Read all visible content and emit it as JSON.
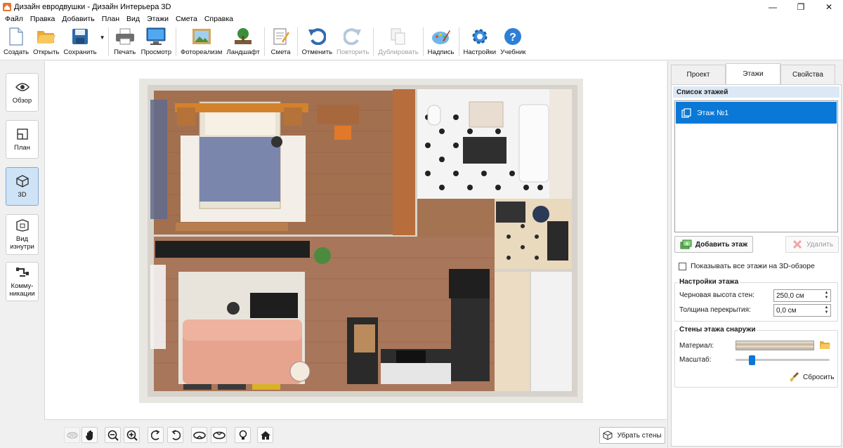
{
  "window": {
    "title": "Дизайн евродвушки - Дизайн Интерьера 3D",
    "minimize": "—",
    "maximize": "❐",
    "close": "✕"
  },
  "menu": [
    "Файл",
    "Правка",
    "Добавить",
    "План",
    "Вид",
    "Этажи",
    "Смета",
    "Справка"
  ],
  "toolbar": {
    "create": "Создать",
    "open": "Открыть",
    "save": "Сохранить",
    "print": "Печать",
    "preview": "Просмотр",
    "photorealism": "Фотореализм",
    "landscape": "Ландшафт",
    "estimate": "Смета",
    "undo": "Отменить",
    "redo": "Повторить",
    "duplicate": "Дублировать",
    "caption": "Надпись",
    "settings": "Настройки",
    "tutorial": "Учебник"
  },
  "sidebar": {
    "overview": "Обзор",
    "plan": "План",
    "view3d": "3D",
    "inside_view": "Вид изнутри",
    "communications": "Комму- никации"
  },
  "bottombar": {
    "remove_walls": "Убрать стены"
  },
  "rightpanel": {
    "tabs": [
      "Проект",
      "Этажи",
      "Свойства"
    ],
    "active_tab": "Этажи",
    "floor_list_title": "Список этажей",
    "floors": [
      "Этаж №1"
    ],
    "add_floor": "Добавить этаж",
    "delete": "Удалить",
    "show_all_floors": "Показывать все этажи на 3D-обзоре",
    "floor_settings_title": "Настройки этажа",
    "wall_height_label": "Черновая высота стен:",
    "wall_height_value": "250,0 см",
    "slab_thickness_label": "Толщина перекрытия:",
    "slab_thickness_value": "0,0 см",
    "outer_walls_title": "Стены этажа снаружи",
    "material_label": "Материал:",
    "scale_label": "Масштаб:",
    "scale_value": 0.17,
    "reset": "Сбросить"
  },
  "colors": {
    "accent": "#0a78d7",
    "floor_wood": "#a8765a",
    "bed_blanket": "#7b86ad",
    "sofa": "#e6a48f",
    "kitchen_counter": "#2d2d2d",
    "bathroom_tile": "#f4f4f4"
  }
}
